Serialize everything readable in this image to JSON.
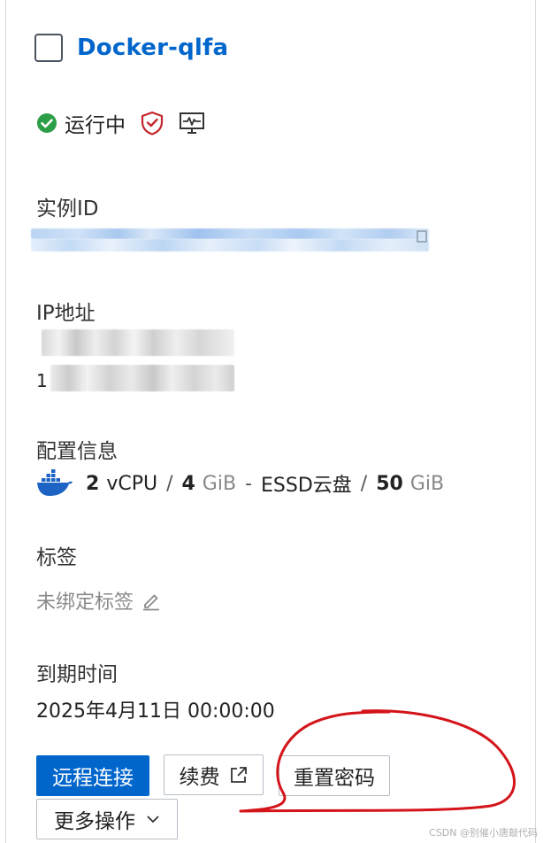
{
  "instance": {
    "name": "Docker-qlfa",
    "status": "运行中"
  },
  "sections": {
    "instance_id_label": "实例ID",
    "ip_label": "IP地址",
    "ip_visible_prefix": "1",
    "config_label": "配置信息",
    "tags_label": "标签",
    "tags_empty": "未绑定标签",
    "expiry_label": "到期时间",
    "expiry_value": "2025年4月11日 00:00:00"
  },
  "spec": {
    "cpu_count": "2",
    "cpu_unit": "vCPU",
    "sep1": "/",
    "mem": "4",
    "mem_unit": "GiB",
    "dash": "-",
    "disk_type": "ESSD云盘",
    "sep2": "/",
    "disk": "50",
    "disk_unit": "GiB"
  },
  "actions": {
    "remote_connect": "远程连接",
    "renew": "续费",
    "reset_password": "重置密码",
    "more_actions": "更多操作"
  },
  "colors": {
    "accent": "#0066cc",
    "status_ok": "#2b9e47",
    "security": "#c3252c",
    "annotation": "#d4141b"
  },
  "icons": [
    "check-circle-icon",
    "shield-icon",
    "monitor-icon",
    "docker-icon",
    "edit-icon",
    "external-link-icon",
    "chevron-down-icon"
  ],
  "watermark": "CSDN @别催小唐敲代码"
}
